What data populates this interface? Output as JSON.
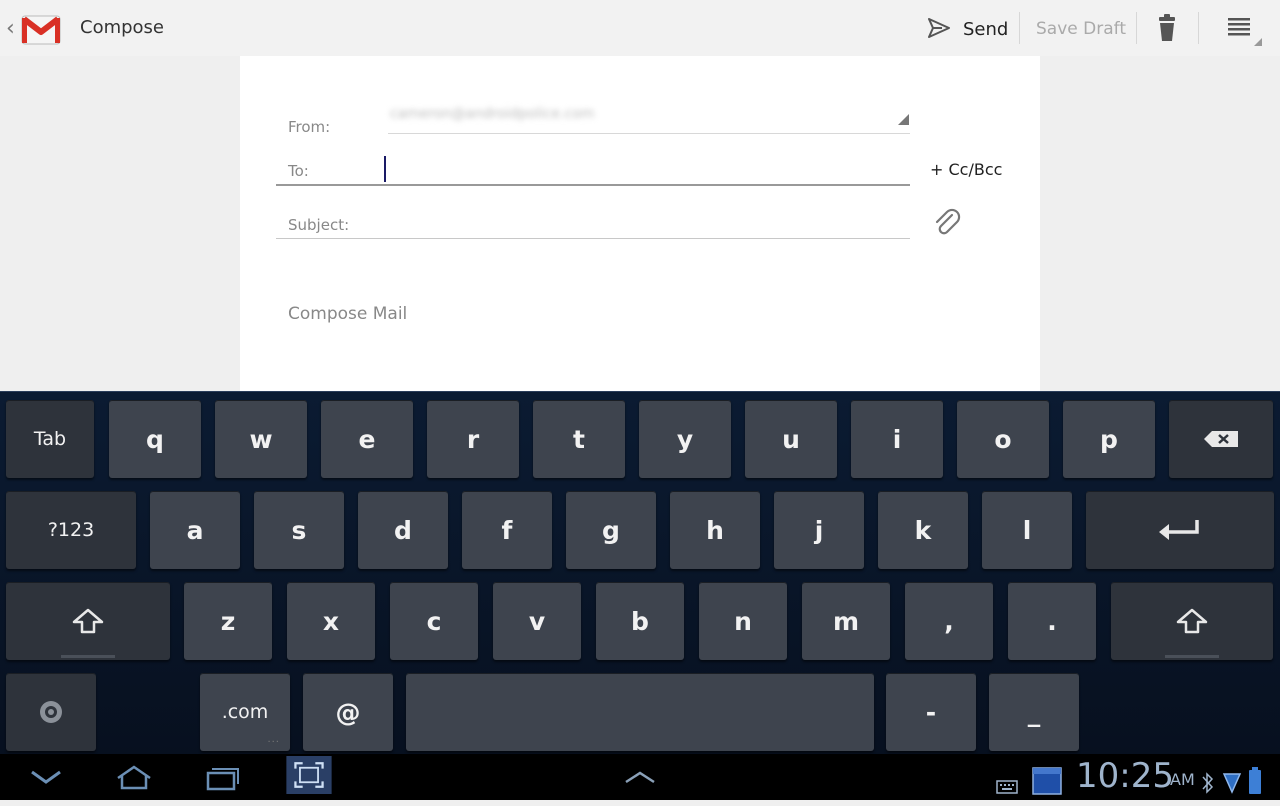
{
  "action_bar": {
    "title": "Compose",
    "send_label": "Send",
    "save_draft_label": "Save Draft"
  },
  "compose": {
    "from_label": "From:",
    "from_value": "cameron@androidpolice.com",
    "to_label": "To:",
    "to_value": "",
    "cc_bcc_label": "+ Cc/Bcc",
    "subject_label": "Subject:",
    "subject_value": "",
    "body_placeholder": "Compose Mail"
  },
  "keyboard": {
    "rows": [
      [
        {
          "label": "Tab",
          "kind": "func",
          "name": "tab-key"
        },
        {
          "label": "q"
        },
        {
          "label": "w"
        },
        {
          "label": "e"
        },
        {
          "label": "r"
        },
        {
          "label": "t"
        },
        {
          "label": "y"
        },
        {
          "label": "u"
        },
        {
          "label": "i"
        },
        {
          "label": "o"
        },
        {
          "label": "p"
        },
        {
          "label": "",
          "kind": "func",
          "icon": "backspace",
          "name": "backspace-key"
        }
      ],
      [
        {
          "label": "?123",
          "kind": "func",
          "name": "symbols-key"
        },
        {
          "label": "a"
        },
        {
          "label": "s"
        },
        {
          "label": "d"
        },
        {
          "label": "f"
        },
        {
          "label": "g"
        },
        {
          "label": "h"
        },
        {
          "label": "j"
        },
        {
          "label": "k"
        },
        {
          "label": "l"
        },
        {
          "label": "",
          "kind": "func",
          "icon": "enter",
          "name": "enter-key"
        }
      ],
      [
        {
          "label": "",
          "kind": "func",
          "icon": "shift",
          "name": "shift-left-key"
        },
        {
          "label": "z"
        },
        {
          "label": "x"
        },
        {
          "label": "c"
        },
        {
          "label": "v"
        },
        {
          "label": "b"
        },
        {
          "label": "n"
        },
        {
          "label": "m"
        },
        {
          "label": ","
        },
        {
          "label": "."
        },
        {
          "label": "",
          "kind": "func",
          "icon": "shift",
          "name": "shift-right-key"
        }
      ],
      [
        {
          "label": "",
          "kind": "func",
          "icon": "settings",
          "name": "settings-key"
        },
        {
          "label": ".com",
          "kind": "small",
          "name": "dotcom-key"
        },
        {
          "label": "@",
          "name": "at-key"
        },
        {
          "label": "",
          "name": "space-key"
        },
        {
          "label": "-",
          "name": "dash-key"
        },
        {
          "label": "_",
          "name": "underscore-key"
        }
      ]
    ]
  },
  "system_bar": {
    "time": "10:25",
    "ampm": "AM"
  },
  "colors": {
    "accent_clock": "#9fb4cc",
    "gmail_red": "#d93025",
    "keyboard_bg": "#0b1b32"
  },
  "icons": [
    "back-chevron-icon",
    "gmail-logo-icon",
    "send-icon",
    "trash-icon",
    "menu-icon",
    "dropdown-icon",
    "paperclip-icon",
    "backspace-icon",
    "enter-icon",
    "shift-icon",
    "settings-icon",
    "back-nav-icon",
    "home-icon",
    "recent-apps-icon",
    "screenshot-icon",
    "up-caret-icon",
    "keyboard-icon",
    "calendar-icon",
    "bluetooth-icon",
    "signal-icon",
    "battery-icon"
  ]
}
